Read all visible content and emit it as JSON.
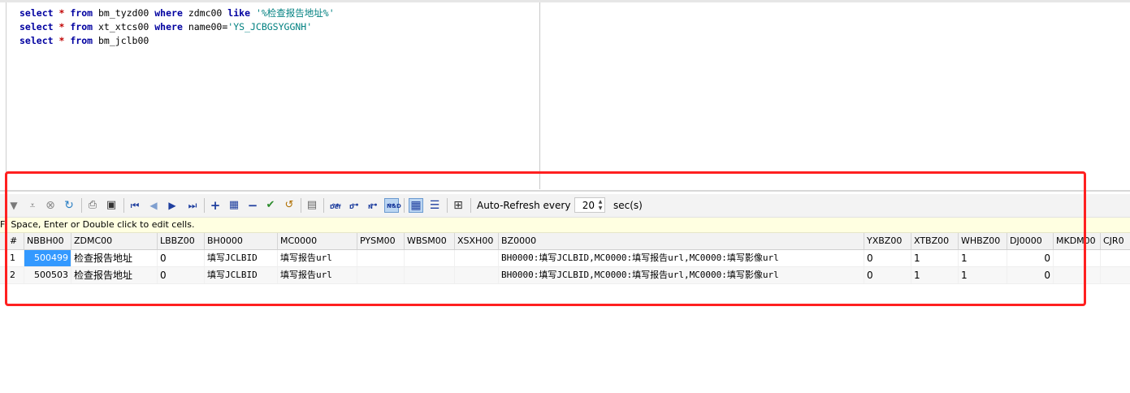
{
  "editor": {
    "lines": [
      {
        "kw1": "select",
        "op": "*",
        "kw2": "from",
        "table": "bm_tyzd00",
        "kw3": "where",
        "field": "zdmc00",
        "kw4": "like",
        "str": "'%检查报告地址%'"
      },
      {
        "kw1": "select",
        "op": "*",
        "kw2": "from",
        "table": "xt_xtcs00",
        "kw3": "where",
        "field": "name00=",
        "kw4": "",
        "str": "'YS_JCBGSYGGNH'"
      },
      {
        "kw1": "select",
        "op": "*",
        "kw2": "from",
        "table": "bm_jclb00",
        "kw3": "",
        "field": "",
        "kw4": "",
        "str": ""
      }
    ]
  },
  "toolbar": {
    "filter_def": "Def",
    "filter_d": "D",
    "filter_n": "N",
    "filter_nd": "N&D",
    "auto_refresh_label": "Auto-Refresh every",
    "refresh_value": "20",
    "refresh_unit": "sec(s)"
  },
  "hint": "F, Space, Enter or Double click to edit cells.",
  "grid": {
    "columns": [
      "#",
      "NBBH00",
      "ZDMC00",
      "LBBZ00",
      "BH0000",
      "MC0000",
      "PYSM00",
      "WBSM00",
      "XSXH00",
      "BZ0000",
      "YXBZ00",
      "XTBZ00",
      "WHBZ00",
      "DJ0000",
      "MKDM00",
      "CJR0"
    ],
    "rows": [
      [
        "1",
        "500499",
        "检查报告地址",
        "0",
        "填写JCLBID",
        "填写报告url",
        "",
        "",
        "",
        "BH0000:填写JCLBID,MC0000:填写报告url,MC0000:填写影像url",
        "0",
        "1",
        "1",
        "0",
        "",
        ""
      ],
      [
        "2",
        "500503",
        "检查报告地址",
        "0",
        "填写JCLBID",
        "填写报告url",
        "",
        "",
        "",
        "BH0000:填写JCLBID,MC0000:填写报告url,MC0000:填写影像url",
        "0",
        "1",
        "1",
        "0",
        "",
        ""
      ]
    ]
  },
  "colors": {
    "highlight": "#ff2020",
    "selection": "#3399ff",
    "keyword": "#0000a0",
    "string": "#008080",
    "operator": "#c00000"
  }
}
